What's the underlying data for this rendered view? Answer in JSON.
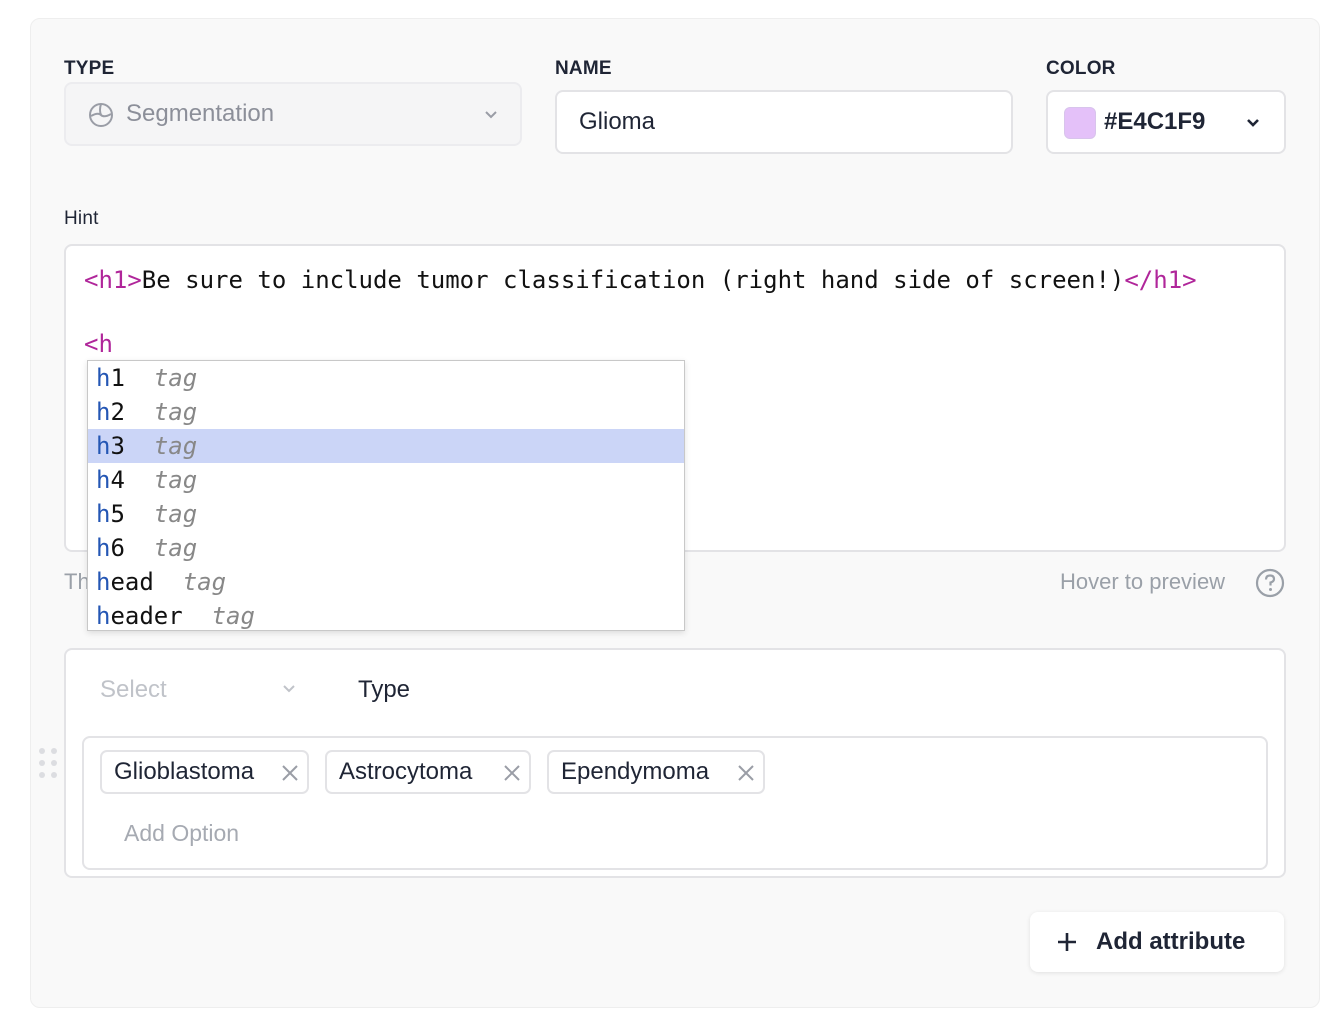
{
  "type_field": {
    "label": "TYPE",
    "value": "Segmentation",
    "icon": "segmentation-icon"
  },
  "name_field": {
    "label": "NAME",
    "value": "Glioma"
  },
  "color_field": {
    "label": "COLOR",
    "value": "#E4C1F9",
    "swatch_color": "#E4C1F9"
  },
  "hint": {
    "label": "Hint",
    "line1_open": "<h1>",
    "line1_text": "Be sure to include tumor classification (right hand side of screen!)",
    "line1_close": "</h1>",
    "line2": "<h",
    "below_text_partial": "Th",
    "hover_preview": "Hover to preview",
    "autocomplete": [
      {
        "match": "h",
        "rest": "1",
        "kind": "tag"
      },
      {
        "match": "h",
        "rest": "2",
        "kind": "tag"
      },
      {
        "match": "h",
        "rest": "3",
        "kind": "tag",
        "selected": true
      },
      {
        "match": "h",
        "rest": "4",
        "kind": "tag"
      },
      {
        "match": "h",
        "rest": "5",
        "kind": "tag"
      },
      {
        "match": "h",
        "rest": "6",
        "kind": "tag"
      },
      {
        "match": "h",
        "rest": "ead",
        "kind": "tag"
      },
      {
        "match": "h",
        "rest": "eader",
        "kind": "tag"
      }
    ]
  },
  "attribute": {
    "select_placeholder": "Select",
    "type_label": "Type",
    "options": [
      "Glioblastoma",
      "Astrocytoma",
      "Ependymoma"
    ],
    "add_option_placeholder": "Add Option"
  },
  "add_attribute_label": "Add attribute",
  "colors": {
    "tag": "#b0269a",
    "match": "#2456b4",
    "selected_row": "#cbd5f7"
  }
}
